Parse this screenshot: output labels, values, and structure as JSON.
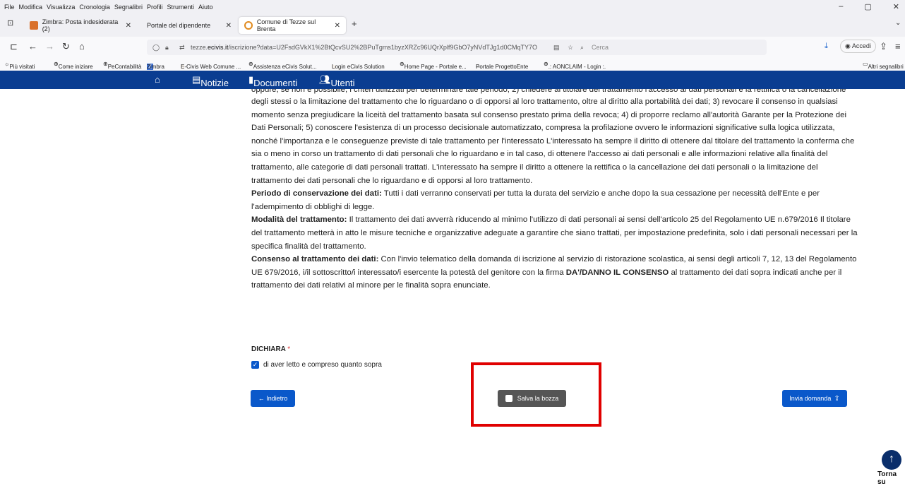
{
  "menu": [
    "File",
    "Modifica",
    "Visualizza",
    "Cronologia",
    "Segnalibri",
    "Profili",
    "Strumenti",
    "Aiuto"
  ],
  "tabs": [
    {
      "label": "Zimbra: Posta indesiderata (2)",
      "close": "✕"
    },
    {
      "label": "Portale del dipendente",
      "close": "✕"
    },
    {
      "label": "Comune di Tezze sul Brenta",
      "close": "✕"
    }
  ],
  "url": {
    "prefix": "tezze.",
    "domain": "ecivis.it",
    "rest": "/iscrizione?data=U2FsdGVkX1%2BtQcvSU2%2BPuTgms1byzXRZc96UQrXplf9GbO7yNVdTJg1d0CMqTY7O"
  },
  "search_placeholder": "Cerca",
  "accedi": "Accedi",
  "bookmarks": [
    "Più visitati",
    "Come iniziare",
    "PeContabilità",
    "Zimbra",
    "E-Civis Web Comune ...",
    "Assistenza eCivis Solut...",
    "Login eCivis Solution",
    "Home Page - Portale e...",
    "Portale ProgettoEnte",
    ".: AONCLAIM - Login :.",
    "Altri segnalibri"
  ],
  "sitenav": {
    "notizie": "Notizie",
    "documenti": "Documenti",
    "utenti": "Utenti"
  },
  "content": {
    "clipped": "oppure, se non è possibile, i criteri utilizzati per determinare tale periodo; 2) chiedere al titolare del trattamento l'accesso ai dati personali e la rettifica o la cancellazione",
    "p1": "degli stessi o la limitazione del trattamento che lo riguardano o di opporsi al loro trattamento, oltre al diritto alla portabilità dei dati; 3) revocare il consenso in qualsiasi momento senza pregiudicare la liceità del trattamento basata sul consenso prestato prima della revoca; 4) di proporre reclamo all'autorità Garante per la Protezione dei Dati Personali; 5) conoscere l'esistenza di un processo decisionale automatizzato, compresa la profilazione ovvero le informazioni significative sulla logica utilizzata, nonché l'importanza e le conseguenze previste di tale trattamento per l'interessato L'interessato ha sempre il diritto di ottenere dal titolare del trattamento la conferma che sia o meno in corso un trattamento di dati personali che lo riguardano e in tal caso, di ottenere l'accesso ai dati personali e alle informazioni relative alla finalità del trattamento, alle categorie di dati personali trattati. L'interessato ha sempre il diritto a ottenere la rettifica o la cancellazione dei dati personali o la limitazione del trattamento dei dati personali che lo riguardano e di opporsi al loro trattamento.",
    "h2": "Periodo di conservazione dei dati:",
    "p2": " Tutti i dati verranno conservati per tutta la durata del servizio e anche dopo la sua cessazione per necessità dell'Ente e per l'adempimento di obblighi di legge.",
    "h3": "Modalità del trattamento:",
    "p3": " Il trattamento dei dati avverrà riducendo al minimo l'utilizzo di dati personali ai sensi dell'articolo 25 del Regolamento UE n.679/2016 Il titolare del trattamento metterà in atto le misure tecniche e organizzative adeguate a garantire che siano trattati, per impostazione predefinita, solo i dati personali necessari per la specifica finalità del trattamento.",
    "h4": "Consenso al trattamento dei dati:",
    "p4a": " Con l'invio telematico della domanda di iscrizione al servizio di ristorazione scolastica, ai sensi degli articoli 7, 12, 13 del Regolamento UE 679/2016, i/il sottoscritto/i interessato/i esercente la potestà del genitore con la firma ",
    "p4b": "DA'/DANNO IL CONSENSO",
    "p4c": " al trattamento dei dati sopra indicati anche per il trattamento dei dati relativi al minore per le finalità sopra enunciate."
  },
  "form": {
    "dichiara": "DICHIARA",
    "required": "*",
    "check_label": "di aver letto e compreso quanto sopra",
    "checked": true
  },
  "buttons": {
    "back": "← Indietro",
    "save": "Salva la bozza",
    "send": "Invia domanda"
  },
  "torna_su": "Torna su",
  "colors": {
    "nav": "#0a3d91",
    "primary": "#0a58ca",
    "highlight": "#e00000"
  }
}
